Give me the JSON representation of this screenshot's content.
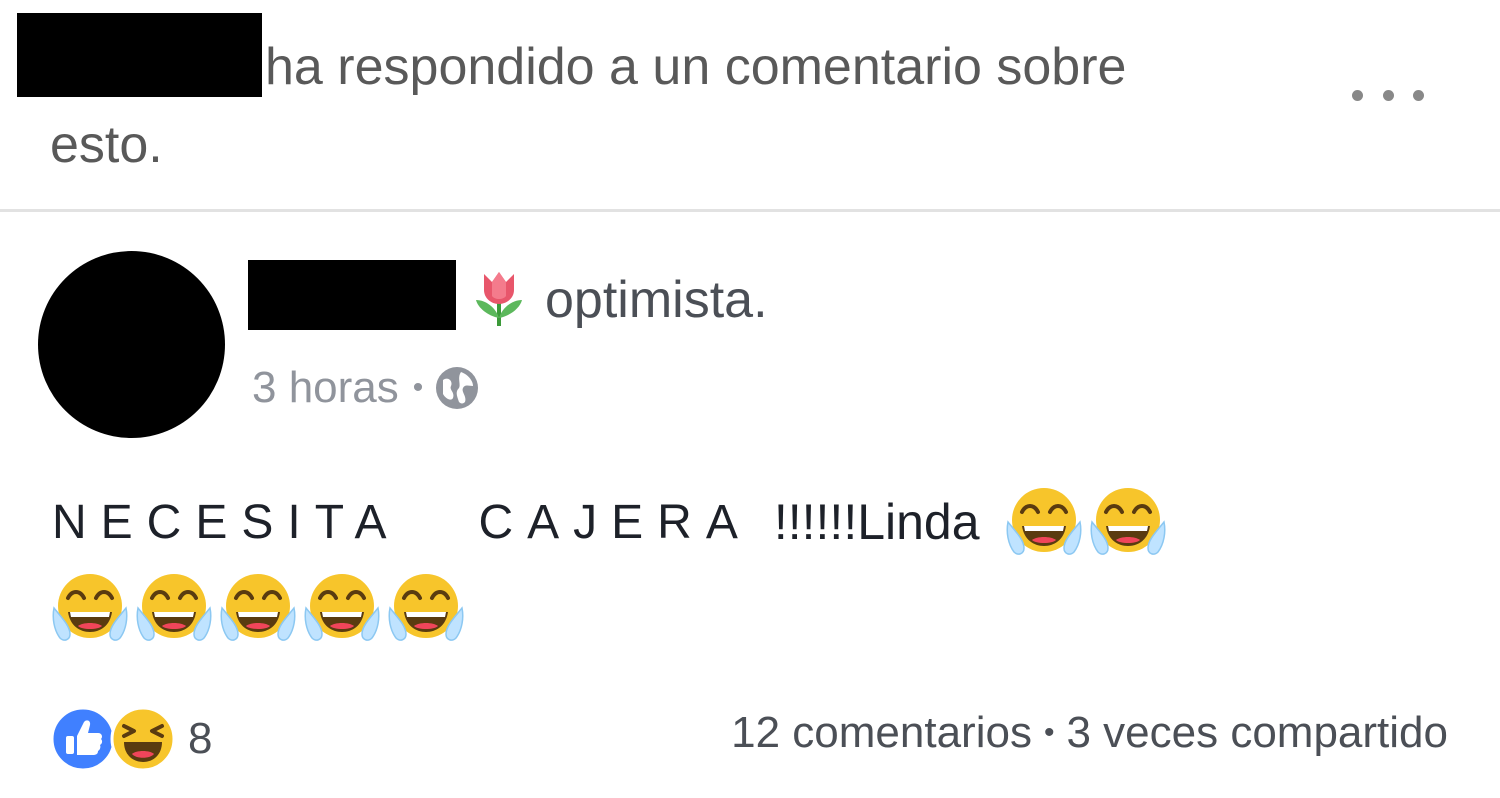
{
  "notification": {
    "text": "ha respondido a un comentario sobre esto."
  },
  "menu": {
    "icon": "more-dots-icon"
  },
  "post": {
    "status": "optimista.",
    "status_icon": "tulip-emoji",
    "time": "3 horas",
    "separator": "•",
    "privacy_icon": "globe-icon",
    "body_spaced_1": "NECESITA",
    "body_spaced_2": "CAJERA",
    "body_tail": "!!!!!!Linda",
    "emoji_icon": "crying-laughing-emoji"
  },
  "footer": {
    "reaction_icons": [
      "like-icon",
      "haha-icon"
    ],
    "reaction_count": "8",
    "comments": "12 comentarios",
    "separator": "•",
    "shares": "3 veces compartido"
  },
  "colors": {
    "like_blue": "#4080ff",
    "emoji_yellow": "#f7c52b",
    "muted_text": "#90949c"
  }
}
